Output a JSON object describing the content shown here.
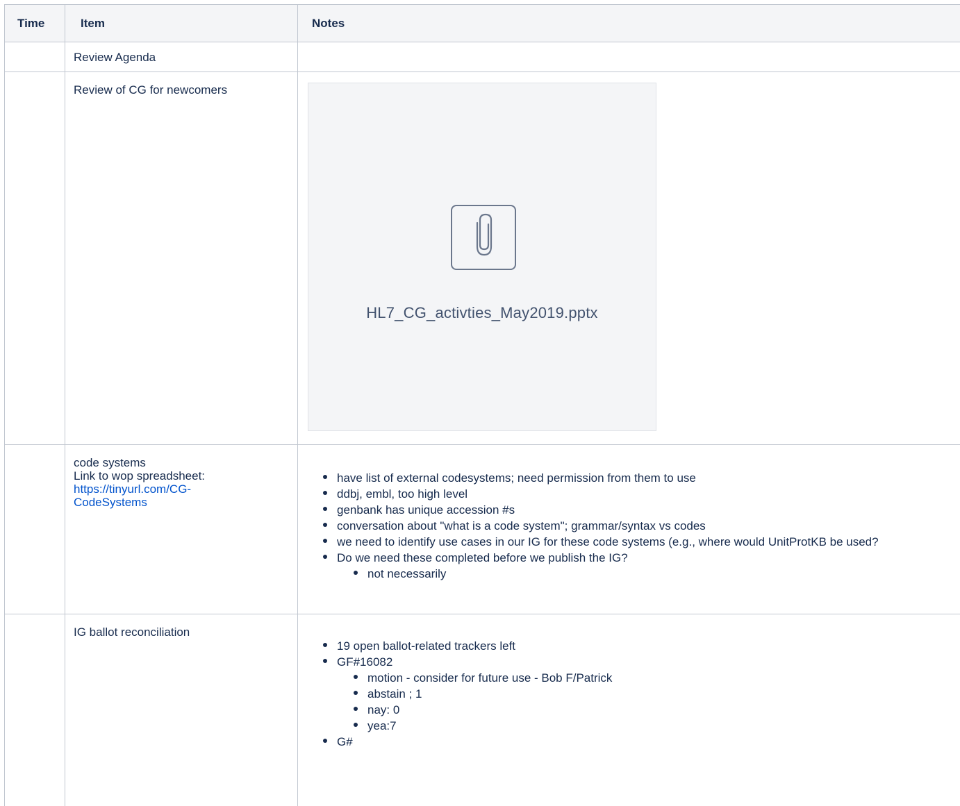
{
  "table": {
    "headers": {
      "time": "Time",
      "item": "Item",
      "notes": "Notes"
    },
    "rows": [
      {
        "time": "",
        "item": "Review Agenda",
        "notes": ""
      },
      {
        "time": "",
        "item": "Review of CG for newcomers",
        "attachment": {
          "file_name": "HL7_CG_activties_May2019.pptx",
          "icon": "paperclip-icon"
        }
      },
      {
        "time": "",
        "item_lines": [
          "code systems",
          "Link to wop spreadsheet:"
        ],
        "item_link": "https://tinyurl.com/CG-CodeSystems",
        "notes": [
          "have list of external codesystems; need permission from them to use",
          "ddbj, embl, too high level",
          "genbank has unique accession #s",
          "conversation about \"what is a code system\"; grammar/syntax vs codes",
          "we need to identify use cases in our IG for these code systems (e.g., where would UnitProtKB be used?",
          "Do we need these completed before we publish the IG?"
        ],
        "sub_notes": [
          "not necessarily"
        ]
      },
      {
        "time": "",
        "item": "IG ballot reconciliation",
        "notes": [
          "19 open ballot-related trackers left",
          "GF#16082",
          "G#"
        ],
        "sub_notes": [
          "motion - consider for future use - Bob F/Patrick",
          "abstain ; 1",
          "nay: 0",
          "yea:7"
        ]
      }
    ]
  },
  "colors": {
    "border": "#c1c7d0",
    "header_bg": "#f4f5f7",
    "link": "#0052cc",
    "text": "#172b4d"
  }
}
